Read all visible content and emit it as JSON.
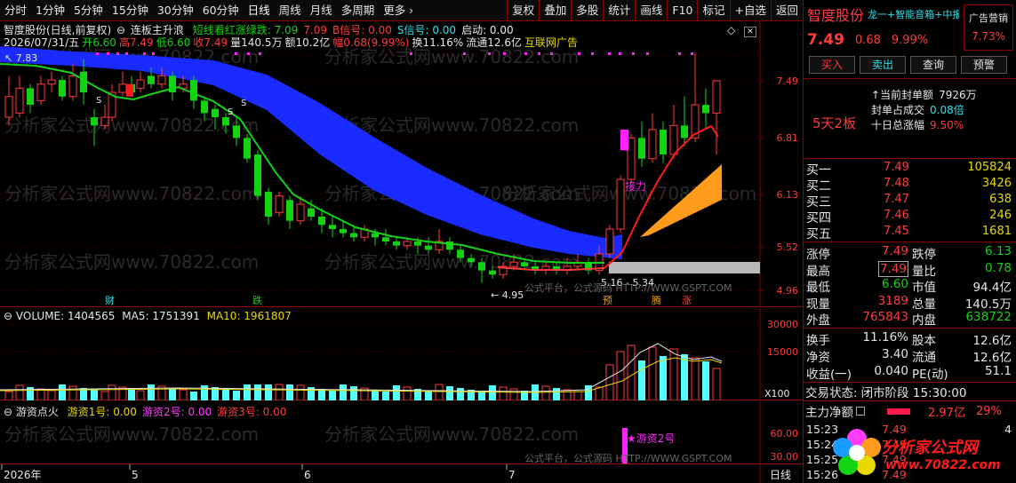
{
  "toolbar": {
    "periods": [
      "分时",
      "1分钟",
      "5分钟",
      "15分钟",
      "30分钟",
      "60分钟",
      "日线",
      "周线",
      "月线",
      "多周期",
      "更多"
    ],
    "more_arrow": "›",
    "tools": [
      "复权",
      "叠加",
      "多股",
      "统计",
      "画线",
      "F10",
      "标记",
      "+自选",
      "返回"
    ]
  },
  "chart_header": {
    "line1_name": "智度股份(日线,前复权)",
    "line1_formula": "连板主升浪",
    "line1_params": [
      {
        "label": "短线看红涨绿跌: 7.09",
        "color": "#13d313"
      },
      {
        "label": "7.09",
        "color": "#ff3b3b"
      },
      {
        "label": "B信号: 0.00",
        "color": "#ff3b3b"
      },
      {
        "label": "S信号: 0.00",
        "color": "#2fe0e8"
      },
      {
        "label": "启动: 0.00",
        "color": "#e6e6e6"
      }
    ],
    "line2": [
      {
        "label": "2026/07/31/五",
        "color": "#e6e6e6"
      },
      {
        "label": "开6.60",
        "color": "#13d313"
      },
      {
        "label": "高7.49",
        "color": "#ff3b3b"
      },
      {
        "label": "低6.60",
        "color": "#13d313"
      },
      {
        "label": "收7.49",
        "color": "#ff3b3b"
      },
      {
        "label": "量140.5万",
        "color": "#e6e6e6"
      },
      {
        "label": "额10.2亿",
        "color": "#e6e6e6"
      },
      {
        "label": "幅0.68(9.99%)",
        "color": "#ff3b3b"
      },
      {
        "label": "换11.16%",
        "color": "#e6e6e6"
      },
      {
        "label": "流通12.6亿",
        "color": "#e6e6e6"
      },
      {
        "label": "互联网广告",
        "color": "#e8d900"
      }
    ]
  },
  "main_axis": {
    "ticks": [
      "7.49",
      "6.81",
      "6.13",
      "5.52",
      "4.96"
    ]
  },
  "annotations": {
    "high_label": "7.83",
    "low_label": "4.95",
    "range_label": "5.16 - 5.34",
    "jieli": "接力",
    "s_marks": [
      "S",
      "S",
      "S"
    ],
    "watermark_site": "分析家公式网www.70822.com",
    "watermark_gs": "公式平台，公式源码 HTTP://WWW.GSPT.COM",
    "badges": [
      {
        "label": "财",
        "color": "#2fe0e8"
      },
      {
        "label": "跌",
        "color": "#13d313"
      },
      {
        "label": "预",
        "color": "#e8a000"
      },
      {
        "label": "腾",
        "color": "#e8a000"
      },
      {
        "label": "涨",
        "color": "#ff3b3b"
      }
    ]
  },
  "volume": {
    "title": "VOLUME: 1404565",
    "ma5": "MA5: 1751391",
    "ma10": "MA10: 1961807",
    "axis": [
      "30000",
      "15000"
    ],
    "unit": "X100"
  },
  "indicator": {
    "title": "游资点火",
    "params": [
      {
        "label": "游资1号: 0.00",
        "color": "#e8d900"
      },
      {
        "label": "游资2号: 0.00",
        "color": "#ff3bff"
      },
      {
        "label": "游资3号: 0.00",
        "color": "#ff3b3b"
      }
    ],
    "axis": [
      "60.00",
      "30.00"
    ],
    "marker_label": "游资2号"
  },
  "time_axis": {
    "labels": [
      "2026年",
      "5",
      "6",
      "7"
    ],
    "period": "日线"
  },
  "side": {
    "name": "智度股份",
    "concept": "龙一+智能音箱+中报扬",
    "ad_label": "广告营销",
    "ad_pct": "7.73%",
    "price": "7.49",
    "chg": "0.68",
    "pct": "9.99%",
    "buttons": [
      "买入",
      "卖出",
      "查询",
      "预警"
    ],
    "info": [
      {
        "k": "当前封单额",
        "v": "7926万"
      },
      {
        "k": "封单占成交",
        "v": "0.08倍"
      },
      {
        "k": "十日总涨幅",
        "v": "9.50%"
      }
    ],
    "streak": "5天2板",
    "orderbook": [
      {
        "k": "买一",
        "p": "7.49",
        "q": "105824"
      },
      {
        "k": "买二",
        "p": "7.48",
        "q": "3426"
      },
      {
        "k": "买三",
        "p": "7.47",
        "q": "638"
      },
      {
        "k": "买四",
        "p": "7.46",
        "q": "246"
      },
      {
        "k": "买五",
        "p": "7.45",
        "q": "1681"
      }
    ],
    "quote": [
      {
        "k1": "涨停",
        "v1": "7.49",
        "c1": "#ff3b3b",
        "k2": "跌停",
        "v2": "6.13",
        "c2": "#13d313"
      },
      {
        "k1": "最高",
        "v1": "7.49",
        "c1": "#ff3b3b",
        "k2": "量比",
        "v2": "0.78",
        "c2": "#13d313"
      },
      {
        "k1": "最低",
        "v1": "6.60",
        "c1": "#13d313",
        "k2": "市值",
        "v2": "94.4亿",
        "c2": "#e6e6e6"
      },
      {
        "k1": "现量",
        "v1": "3189",
        "c1": "#ff3b3b",
        "k2": "总量",
        "v2": "140.5万",
        "c2": "#e6e6e6"
      },
      {
        "k1": "外盘",
        "v1": "765843",
        "c1": "#ff3b3b",
        "k2": "内盘",
        "v2": "638722",
        "c2": "#13d313"
      }
    ],
    "quote2": [
      {
        "k1": "换手",
        "v1": "11.16%",
        "k2": "股本",
        "v2": "12.6亿"
      },
      {
        "k1": "净资",
        "v1": "3.40",
        "k2": "流通",
        "v2": "12.6亿"
      },
      {
        "k1": "收益(一)",
        "v1": "0.040",
        "k2": "PE(动)",
        "v2": "51.1"
      }
    ],
    "status_label": "交易状态:",
    "status_value": "闭市阶段 15:30:00",
    "flow_label": "主力净额",
    "flow_value": "2.97亿",
    "flow_pct": "29%",
    "ticks": [
      {
        "t": "15:23",
        "p": "7.49",
        "q": "4"
      },
      {
        "t": "15:24",
        "p": "7.49",
        "q": ""
      },
      {
        "t": "15:25",
        "p": "7.49",
        "q": ""
      },
      {
        "t": "15:26",
        "p": "7.49",
        "q": ""
      }
    ],
    "logo_text": "分析家公式网",
    "logo_url": "www.70822.com"
  },
  "colors": {
    "up": "#ff3b3b",
    "down": "#13d313",
    "band": "#1a2bff",
    "orange": "#ff9b1a",
    "magenta": "#ff22ff",
    "grid": "#8b0000"
  }
}
